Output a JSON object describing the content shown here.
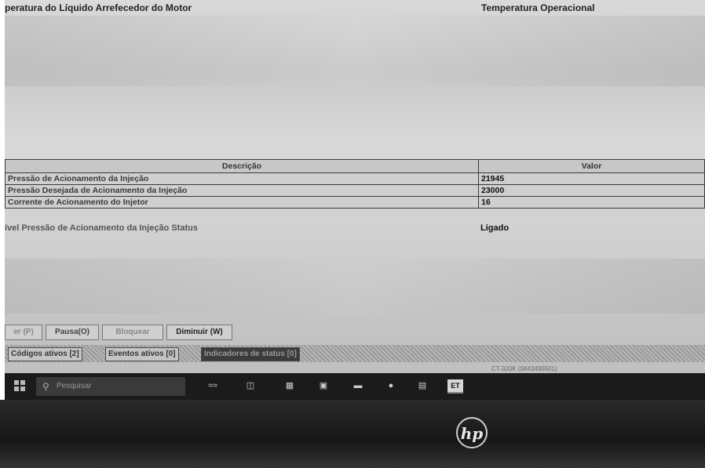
{
  "header": {
    "left_title": "peratura do Líquido Arrefecedor do Motor",
    "right_title": "Temperatura Operacional"
  },
  "table": {
    "columns": [
      "Descrição",
      "Valor"
    ],
    "rows": [
      {
        "description": "Pressão de Acionamento da Injeção",
        "value": "21945"
      },
      {
        "description": "Pressão Desejada de Acionamento da Injeção",
        "value": "23000"
      },
      {
        "description": "Corrente de Acionamento do Injetor",
        "value": "16"
      }
    ]
  },
  "status": {
    "label": "ível Pressão de Acionamento da Injeção Status",
    "value": "Ligado"
  },
  "buttons": {
    "hold": "er (P)",
    "pause": "Pausa(O)",
    "lock": "Bloquear",
    "decrease": "Diminuir (W)"
  },
  "status_tabs": {
    "codes": "Códigos ativos [2]",
    "events": "Eventos ativos [0]",
    "indicators": "Indicadores de status [0]"
  },
  "version": "CT-320K (0443490501)",
  "taskbar": {
    "search_placeholder": "Pesquisar",
    "app_label": "ET"
  },
  "logo_text": "hp"
}
